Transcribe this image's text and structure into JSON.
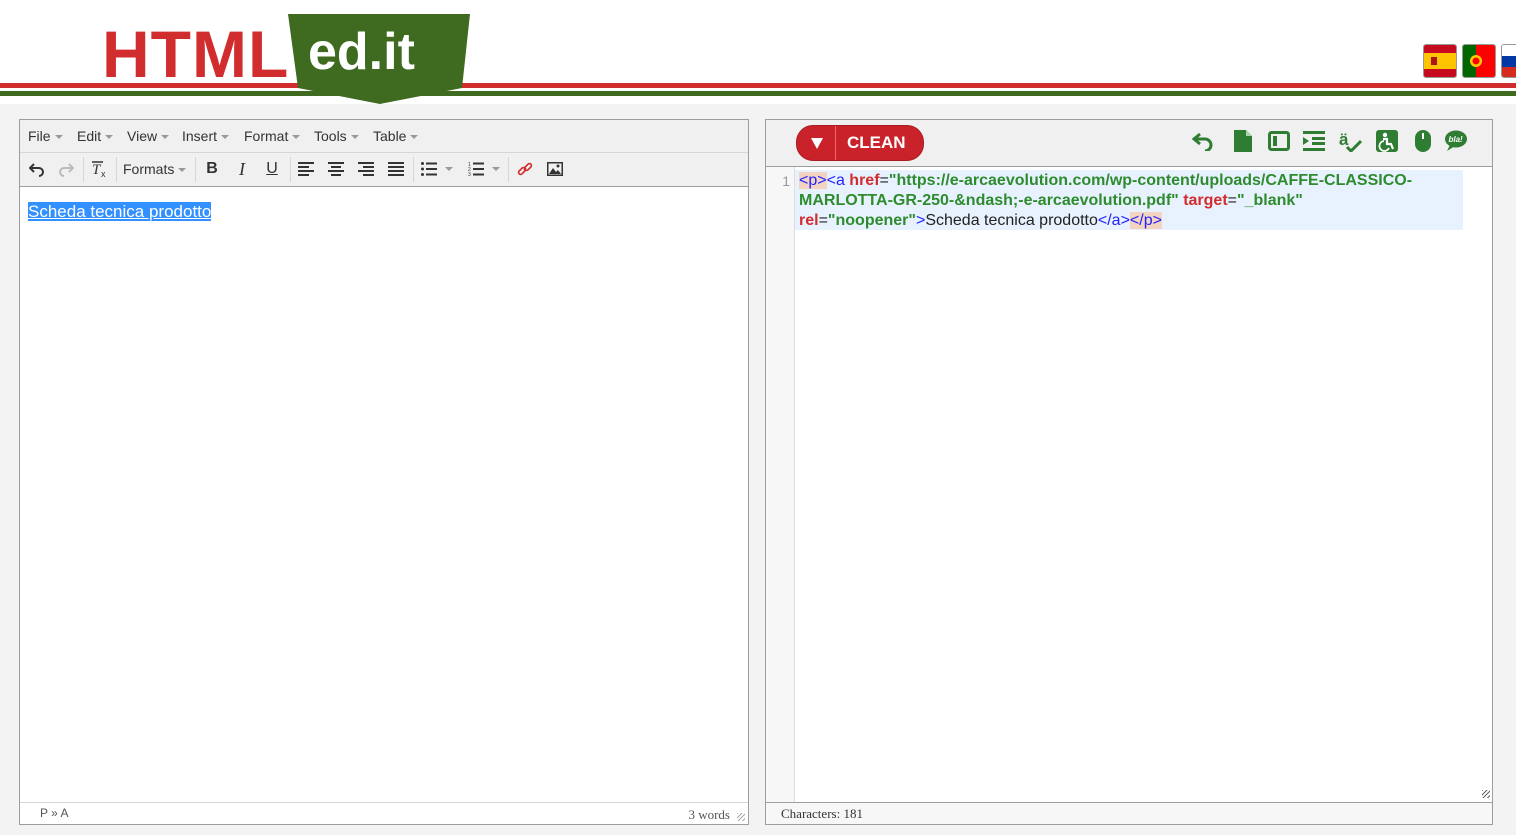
{
  "header": {
    "brand_html": "HTML",
    "brand_ed": "ed.it",
    "flags": [
      "spanish-flag-icon",
      "portuguese-flag-icon",
      "russian-flag-icon"
    ]
  },
  "editor": {
    "menu": [
      "File",
      "Edit",
      "View",
      "Insert",
      "Format",
      "Tools",
      "Table"
    ],
    "toolbar": {
      "formats_label": "Formats",
      "icons": [
        "undo-icon",
        "redo-icon",
        "clear-formatting-icon",
        "bold-icon",
        "italic-icon",
        "underline-icon",
        "align-left-icon",
        "align-center-icon",
        "align-right-icon",
        "align-justify-icon",
        "bullet-list-icon",
        "numbered-list-icon",
        "link-icon",
        "image-icon"
      ]
    },
    "content_text": "Scheda tecnica prodotto",
    "status": {
      "path": "P » A",
      "word_count": "3 words"
    }
  },
  "code": {
    "clean_label": "CLEAN",
    "toolbar_icons": [
      "undo-icon",
      "new-document-icon",
      "frame-icon",
      "indent-icon",
      "spellcheck-icon",
      "accessibility-icon",
      "mouse-icon",
      "speech-bubble-icon"
    ],
    "line_number": "1",
    "tokens": {
      "open_p": "<p>",
      "open_a": "<a",
      "href_attr": "href",
      "href_val": "\"https://e-arcaevolution.com/wp-content/uploads/CAFFE-CLASSICO-MARLOTTA-GR-250-&ndash;-e-arcaevolution.pdf\"",
      "target_attr": "target",
      "target_val": "\"_blank\"",
      "rel_attr": "rel",
      "rel_val": "\"noopener\"",
      "close_bracket": ">",
      "link_text": "Scheda tecnica prodotto",
      "close_a": "</a>",
      "close_p": "</p>",
      "eq": "="
    },
    "characters": "Characters: 181"
  },
  "colors": {
    "brand_red": "#d12d2e",
    "brand_green": "#3e6b1f",
    "icon_green": "#2e7d32",
    "selection_blue": "#3390ff"
  }
}
